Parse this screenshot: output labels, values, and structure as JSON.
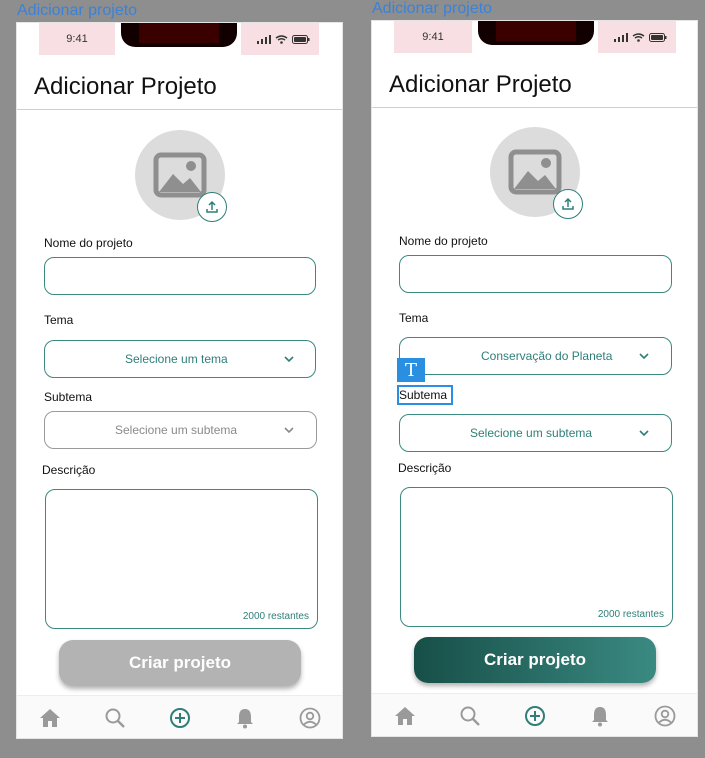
{
  "frames": [
    {
      "frame_label": "Adicionar projeto",
      "status_time": "9:41",
      "title": "Adicionar Projeto",
      "name_label": "Nome do projeto",
      "theme_label": "Tema",
      "theme_value": "Selecione um tema",
      "subtheme_label": "Subtema",
      "subtheme_value": "Selecione um subtema",
      "description_label": "Descrição",
      "counter": "2000 restantes",
      "submit_label": "Criar projeto",
      "submit_state": "disabled"
    },
    {
      "frame_label": "Adicionar projeto",
      "status_time": "9:41",
      "title": "Adicionar Projeto",
      "name_label": "Nome do projeto",
      "theme_label": "Tema",
      "theme_value": "Conservação do Planeta",
      "subtheme_label": "Subtema",
      "subtheme_value": "Selecione um subtema",
      "description_label": "Descrição",
      "counter": "2000 restantes",
      "submit_label": "Criar projeto",
      "submit_state": "enabled"
    }
  ],
  "editor": {
    "text_tool_icon": "T"
  },
  "colors": {
    "accent": "#2f7f78",
    "button_disabled": "#b3b3b3",
    "button_gradient_start": "#174f48",
    "button_gradient_end": "#3a8a82",
    "selection": "#2a8fe0",
    "frame_label": "#3b82d6"
  },
  "icons": {
    "nav": [
      "home-icon",
      "search-icon",
      "add-circle-icon",
      "bell-icon",
      "profile-icon"
    ],
    "avatar": "image-placeholder-icon",
    "upload": "upload-icon",
    "dropdown": "chevron-down-icon"
  }
}
